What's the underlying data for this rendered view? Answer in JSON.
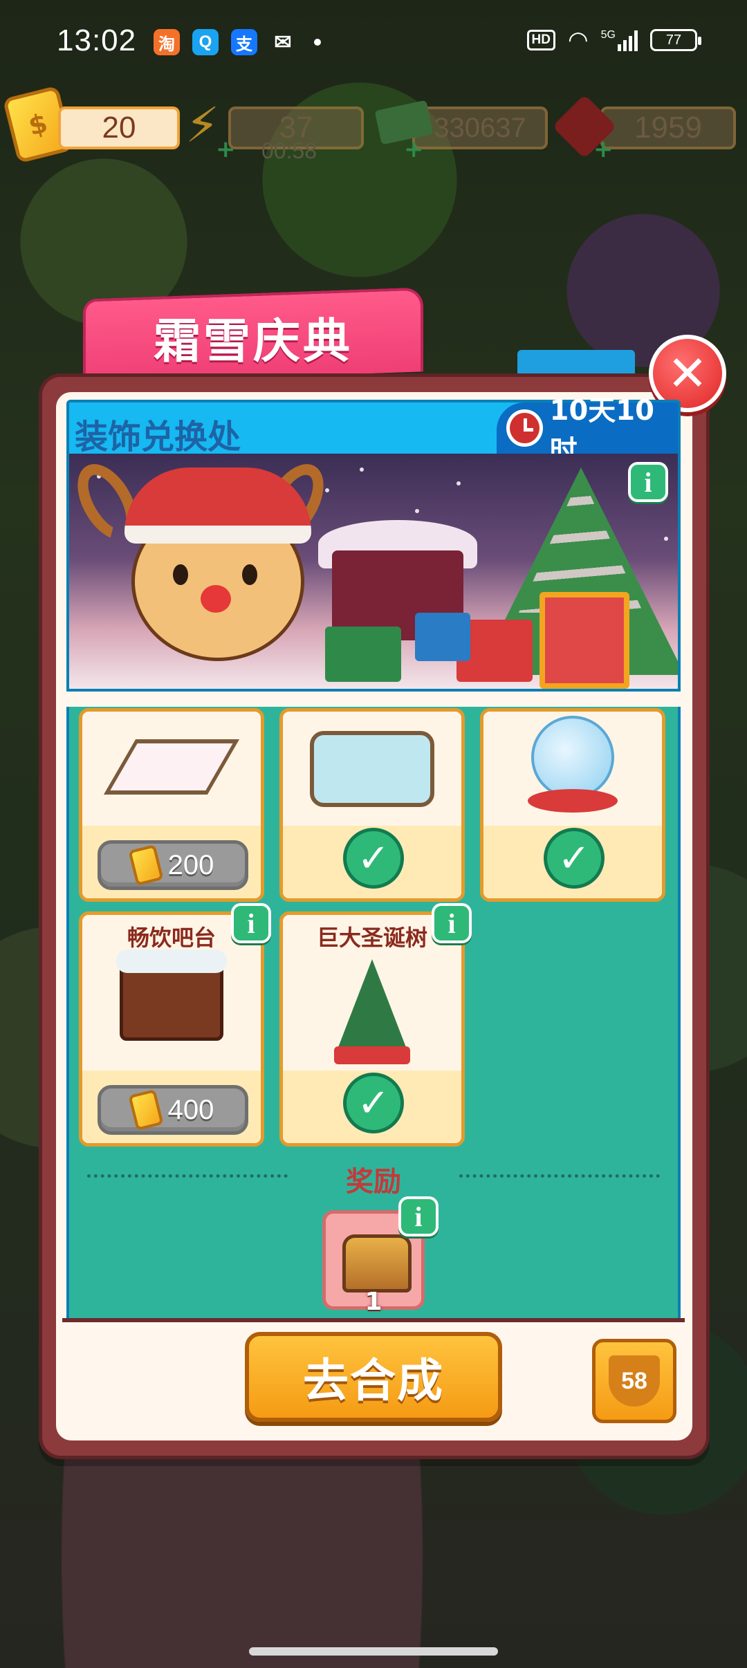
{
  "status_bar": {
    "time": "13:02",
    "hd": "HD",
    "network": "5G",
    "battery": "77"
  },
  "resources": {
    "tickets": "20",
    "energy": "37",
    "energy_timer": "00:58",
    "cash": "330637",
    "gems": "1959"
  },
  "dialog": {
    "tab_title": "霜雪庆典",
    "header_title": "装饰兑换处",
    "time_left": "10天10时"
  },
  "shop": {
    "items": [
      {
        "name": "",
        "price": "200",
        "owned": false
      },
      {
        "name": "",
        "price": "",
        "owned": true
      },
      {
        "name": "",
        "price": "",
        "owned": true
      },
      {
        "name": "畅饮吧台",
        "price": "400",
        "owned": false
      },
      {
        "name": "巨大圣诞树",
        "price": "",
        "owned": true
      }
    ]
  },
  "reward": {
    "title": "奖励",
    "count": "1"
  },
  "actions": {
    "go_button": "去合成",
    "trophy_count": "58"
  },
  "colors": {
    "accent_pink": "#ef3f75",
    "header_blue": "#16b9f2",
    "shop_teal": "#2fb49c",
    "button_orange": "#f59b14",
    "check_green": "#2fb978"
  }
}
